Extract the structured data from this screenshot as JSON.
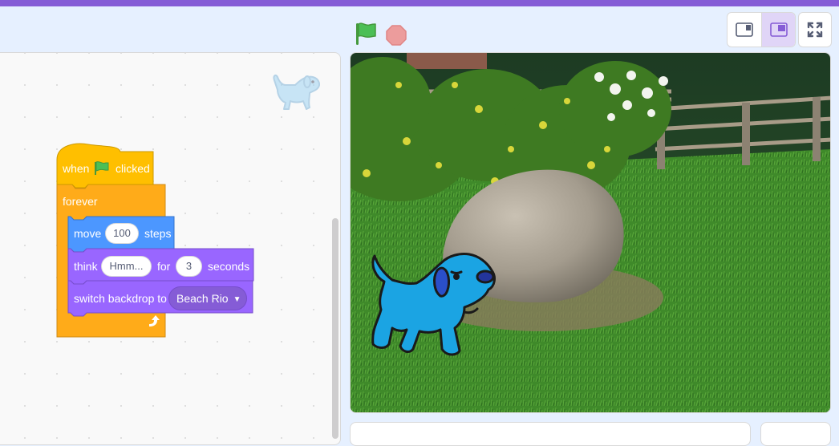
{
  "toolbar": {
    "green_flag_icon": "green-flag-icon",
    "stop_icon": "stop-sign-icon",
    "stage_modes": [
      "small-stage-icon",
      "normal-stage-icon"
    ],
    "fullscreen_icon": "fullscreen-icon"
  },
  "script": {
    "hat": {
      "when": "when",
      "clicked": "clicked"
    },
    "forever_label": "forever",
    "move": {
      "label": "move",
      "steps_value": "100",
      "suffix": "steps"
    },
    "think": {
      "label": "think",
      "message_value": "Hmm...",
      "for": "for",
      "secs_value": "3",
      "suffix": "seconds"
    },
    "switch_backdrop": {
      "label": "switch backdrop to",
      "backdrop_value": "Beach Rio"
    }
  },
  "colors": {
    "accent": "#855cd6",
    "events": "#ffbf00",
    "control": "#ffab19",
    "motion": "#4c97ff",
    "looks": "#9966ff",
    "dog_sprite": "#1ba4e3"
  },
  "stage": {
    "backdrop": "Beach Rio",
    "sprite": "dog"
  }
}
